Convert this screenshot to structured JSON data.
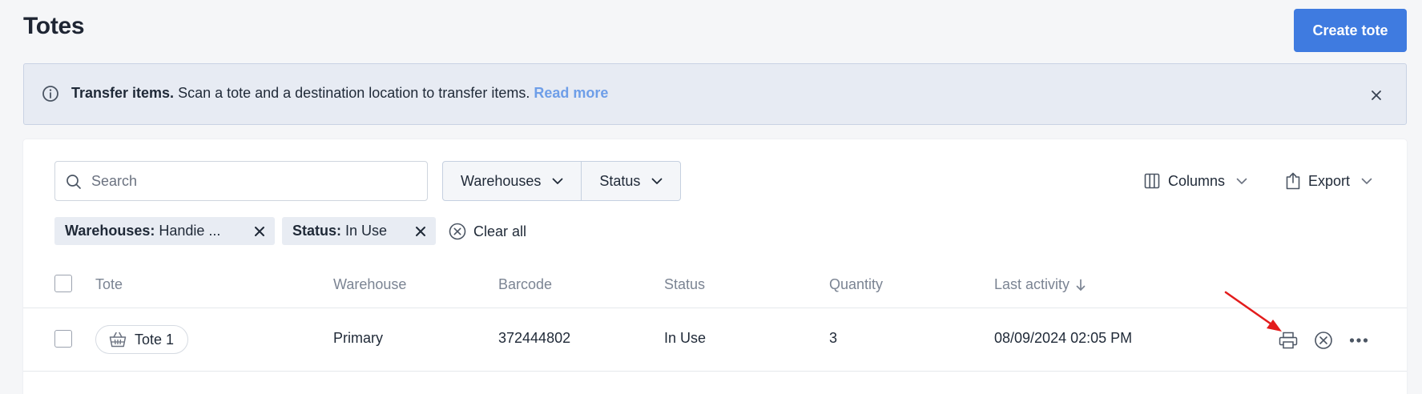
{
  "header": {
    "title": "Totes",
    "create_label": "Create tote"
  },
  "banner": {
    "strong": "Transfer items.",
    "text": " Scan a tote and a destination location to transfer items. ",
    "link": "Read more",
    "icon": "info-icon"
  },
  "search": {
    "placeholder": "Search",
    "value": ""
  },
  "filters": {
    "warehouses_label": "Warehouses",
    "status_label": "Status"
  },
  "toolbar": {
    "columns_label": "Columns",
    "export_label": "Export"
  },
  "chips": [
    {
      "key": "Warehouses:",
      "value": "Handie ..."
    },
    {
      "key": "Status:",
      "value": "In Use"
    }
  ],
  "clear_all_label": "Clear all",
  "table": {
    "headers": [
      "Tote",
      "Warehouse",
      "Barcode",
      "Status",
      "Quantity",
      "Last activity"
    ],
    "rows": [
      {
        "tote": "Tote 1",
        "warehouse": "Primary",
        "barcode": "372444802",
        "status": "In Use",
        "quantity": "3",
        "last_activity": "08/09/2024 02:05 PM"
      }
    ]
  },
  "colors": {
    "primary": "#3f7be0",
    "link": "#6e9ee8",
    "annotation": "#e31c1c"
  }
}
